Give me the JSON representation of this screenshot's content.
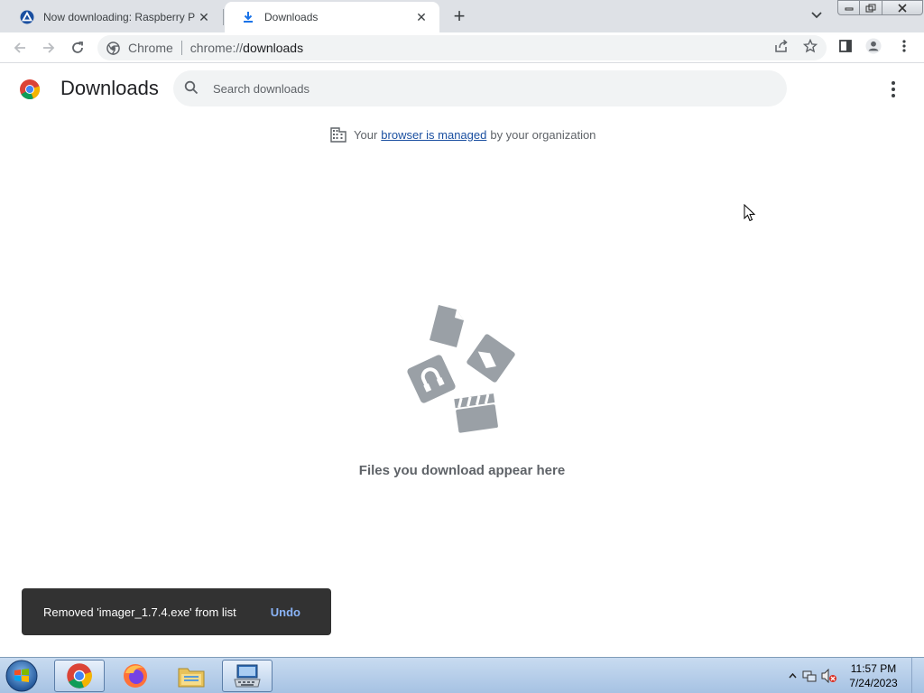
{
  "tabs": [
    {
      "title": "Now downloading: Raspberry Pi",
      "active": false
    },
    {
      "title": "Downloads",
      "active": true
    }
  ],
  "omnibox": {
    "scheme_label": "Chrome",
    "url_host": "chrome://",
    "url_path": "downloads"
  },
  "page": {
    "title": "Downloads",
    "search_placeholder": "Search downloads",
    "managed_prefix": "Your",
    "managed_link": "browser is managed",
    "managed_suffix": "by your organization",
    "empty_message": "Files you download appear here"
  },
  "toast": {
    "message": "Removed 'imager_1.7.4.exe' from list",
    "action": "Undo"
  },
  "taskbar": {
    "apps": [
      {
        "name": "chrome-icon",
        "active": true
      },
      {
        "name": "firefox-icon",
        "active": false
      },
      {
        "name": "file-explorer-icon",
        "active": false
      },
      {
        "name": "on-screen-keyboard-icon",
        "active": false
      }
    ],
    "time": "11:57 PM",
    "date": "7/24/2023"
  },
  "colors": {
    "accent": "#1a73e8",
    "link": "#1a4fa0",
    "toast_bg": "#323232",
    "toast_action": "#8ab4f8"
  }
}
